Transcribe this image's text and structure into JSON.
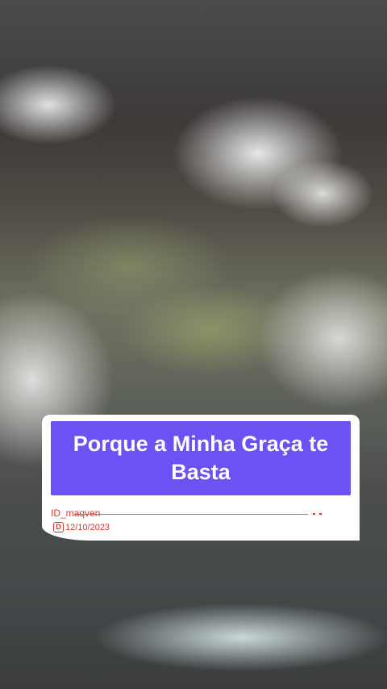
{
  "caption": {
    "title": "Porque a Minha Graça te Basta",
    "user_id": "ID_maqven",
    "date_icon": "D",
    "date": "12/10/2023",
    "banner_color": "#6b52f2",
    "accent_color": "#d33a2c"
  }
}
